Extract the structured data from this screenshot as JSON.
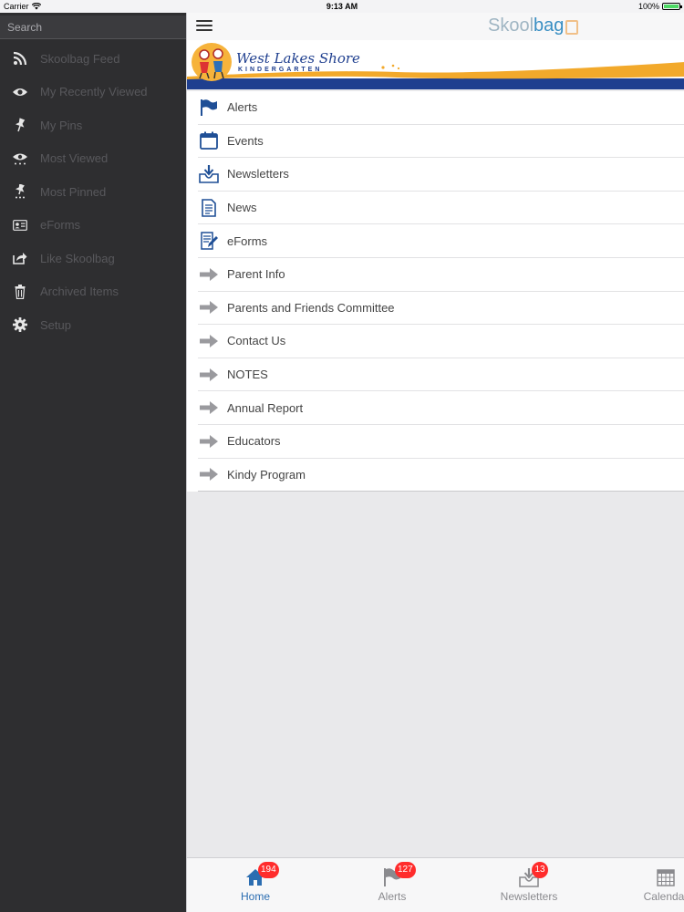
{
  "status_bar": {
    "carrier": "Carrier",
    "time": "9:13 AM",
    "battery": "100%"
  },
  "sidebar": {
    "search_placeholder": "Search",
    "items": [
      {
        "label": "Skoolbag Feed",
        "icon": "rss-icon"
      },
      {
        "label": "My Recently Viewed",
        "icon": "eye-icon"
      },
      {
        "label": "My Pins",
        "icon": "pin-icon"
      },
      {
        "label": "Most Viewed",
        "icon": "eye-dots-icon"
      },
      {
        "label": "Most Pinned",
        "icon": "pin-dots-icon"
      },
      {
        "label": "eForms",
        "icon": "id-card-icon"
      },
      {
        "label": "Like Skoolbag",
        "icon": "share-icon"
      },
      {
        "label": "Archived Items",
        "icon": "trash-icon"
      },
      {
        "label": "Setup",
        "icon": "gear-icon"
      }
    ]
  },
  "header": {
    "brand_a": "Skool",
    "brand_b": "bag"
  },
  "banner": {
    "name": "West Lakes Shore",
    "subtitle": "KINDERGARTEN"
  },
  "menu": [
    {
      "label": "Alerts",
      "icon": "flag-icon"
    },
    {
      "label": "Events",
      "icon": "calendar-icon"
    },
    {
      "label": "Newsletters",
      "icon": "inbox-download-icon"
    },
    {
      "label": "News",
      "icon": "document-icon"
    },
    {
      "label": "eForms",
      "icon": "form-pencil-icon"
    },
    {
      "label": "Parent Info",
      "icon": "arrow-right-icon"
    },
    {
      "label": "Parents and Friends Committee",
      "icon": "arrow-right-icon"
    },
    {
      "label": "Contact Us",
      "icon": "arrow-right-icon"
    },
    {
      "label": "NOTES",
      "icon": "arrow-right-icon"
    },
    {
      "label": "Annual Report",
      "icon": "arrow-right-icon"
    },
    {
      "label": "Educators",
      "icon": "arrow-right-icon"
    },
    {
      "label": "Kindy Program",
      "icon": "arrow-right-icon"
    }
  ],
  "tabs": [
    {
      "label": "Home",
      "badge": "194",
      "icon": "home-icon",
      "active": true
    },
    {
      "label": "Alerts",
      "badge": "127",
      "icon": "flag-icon",
      "active": false
    },
    {
      "label": "Newsletters",
      "badge": "13",
      "icon": "inbox-download-icon",
      "active": false
    },
    {
      "label": "Calendar",
      "badge": "",
      "icon": "calendar-grid-icon",
      "active": false
    }
  ],
  "colors": {
    "accent": "#2b6db1",
    "badge": "#ff2c2c",
    "sidebar_bg": "#2e2e30",
    "banner_orange": "#f2a92b",
    "banner_blue": "#1f3f8f"
  }
}
